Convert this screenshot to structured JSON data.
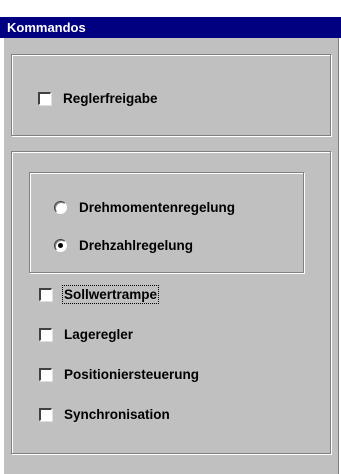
{
  "window": {
    "title": "Kommandos"
  },
  "group1": {
    "checkboxes": [
      {
        "label": "Reglerfreigabe",
        "checked": false
      }
    ]
  },
  "group2": {
    "radio_group": {
      "options": [
        {
          "label": "Drehmomentenregelung",
          "selected": false
        },
        {
          "label": "Drehzahlregelung",
          "selected": true
        }
      ]
    },
    "checkboxes": [
      {
        "label": "Sollwertrampe",
        "checked": false,
        "focused": true
      },
      {
        "label": "Lageregler",
        "checked": false
      },
      {
        "label": "Positioniersteuerung",
        "checked": false
      },
      {
        "label": "Synchronisation",
        "checked": false
      }
    ]
  },
  "colors": {
    "titlebar": "#000080",
    "panel": "#c0c0c0",
    "title_text": "#ffffff"
  }
}
